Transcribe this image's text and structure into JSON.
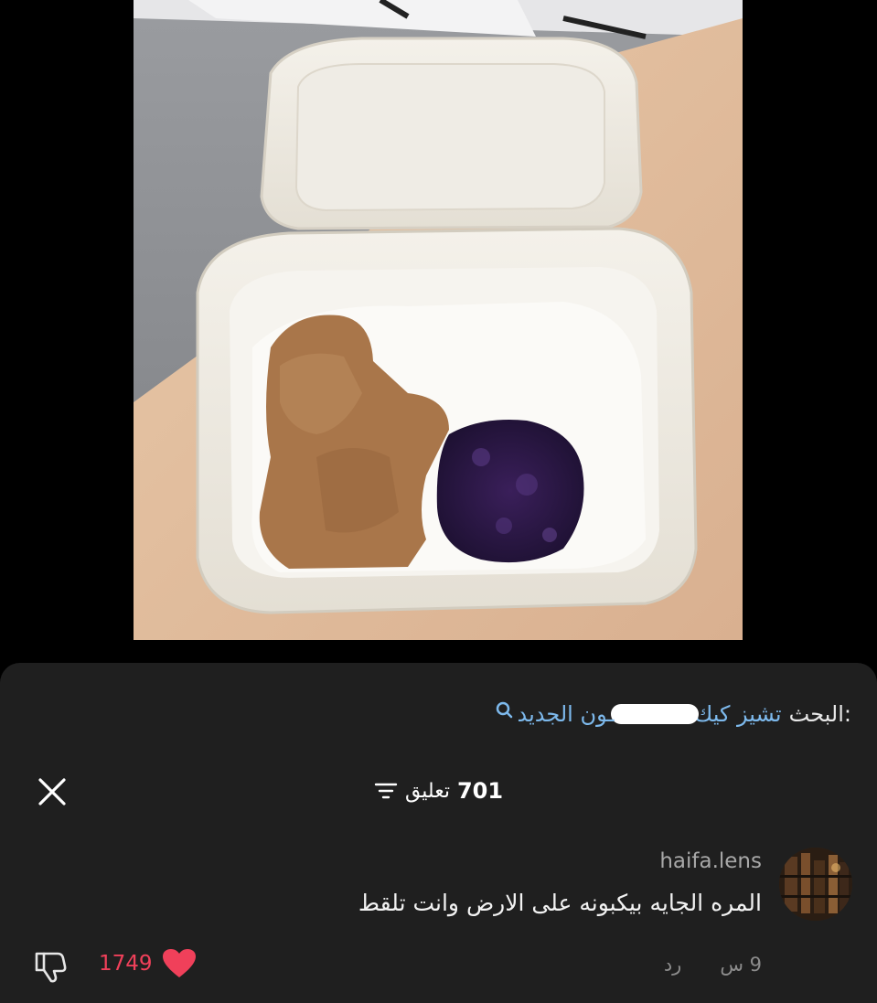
{
  "photo": {
    "alt_icon": "food-photo"
  },
  "search": {
    "prefix": "البحث:",
    "query_part_1": "تشيز كيك",
    "query_part_2": "ـون الجديد",
    "icon": "search-icon"
  },
  "comments_header": {
    "count": "701",
    "label": "تعليق",
    "sort_icon": "sort-icon",
    "close_icon": "close-icon"
  },
  "comment": {
    "username": "haifa.lens",
    "text": "المره الجايه بيكبونه على الارض وانت تلقط",
    "time": "9 س",
    "reply_label": "رد",
    "like_count": "1749",
    "like_icon": "heart-icon",
    "dislike_icon": "thumbs-down-icon",
    "avatar_icon": "avatar"
  },
  "colors": {
    "sheet_bg": "#1f1f1f",
    "link_blue": "#7db9ec",
    "like_red": "#f0405a",
    "muted_gray": "#8c8c8c"
  }
}
